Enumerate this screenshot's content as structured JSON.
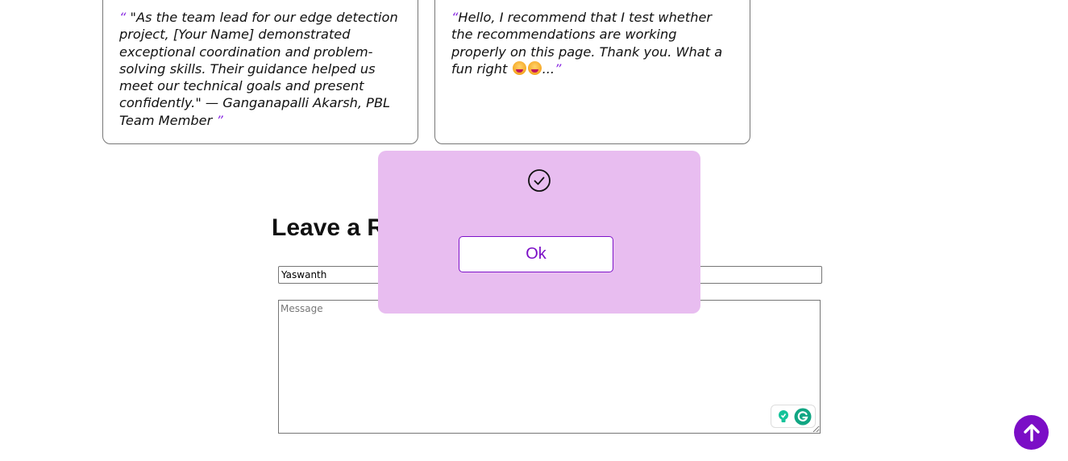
{
  "testimonials": [
    {
      "open_quote": "“",
      "text": " \"As the team lead for our edge detection project, [Your Name] demonstrated exceptional coordination and problem-solving skills. Their guidance helped us meet our technical goals and present confidently.\" — Ganganapalli Akarsh, PBL Team Member ",
      "close_quote": "”"
    },
    {
      "open_quote": "“",
      "text": "Hello, I recommend that I test whether the recommendations are working properly on this page. Thank you. What a fun right",
      "text_after_emoji": "...",
      "close_quote": "”"
    }
  ],
  "review_form": {
    "title": "Leave a Review",
    "name_value": "Yaswanth",
    "message_placeholder": "Message"
  },
  "modal": {
    "icon": "check-circle-icon",
    "ok_label": "Ok"
  },
  "colors": {
    "accent": "#7b0ec6",
    "modal_bg": "#e8bdf0",
    "quote_mark": "#8a2be2"
  }
}
